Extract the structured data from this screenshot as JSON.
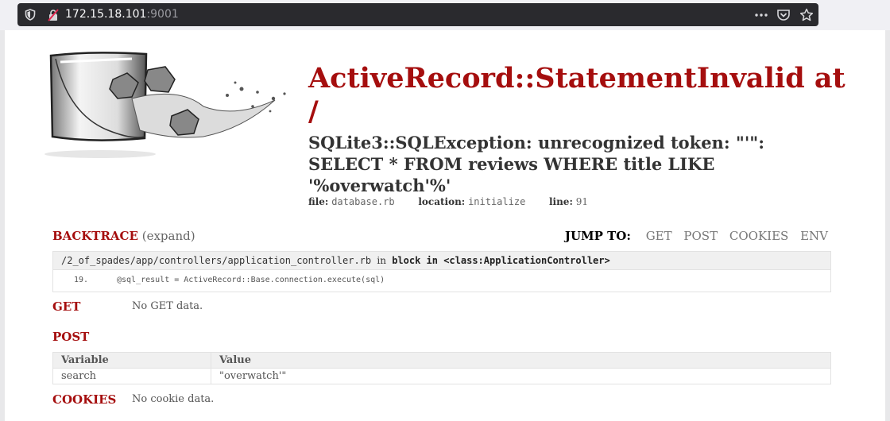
{
  "browser": {
    "url_host": "172.15.18.101",
    "url_port": ":9001",
    "icons": [
      "shield-icon",
      "insecure-lock-icon",
      "more-icon",
      "pocket-icon",
      "bookmark-star-icon"
    ]
  },
  "error": {
    "title": "ActiveRecord::StatementInvalid at /",
    "message": "SQLite3::SQLException: unrecognized token: \"'\": SELECT * FROM reviews WHERE title LIKE '%overwatch'%'",
    "file_label": "file:",
    "file": "database.rb",
    "location_label": "location:",
    "location": "initialize",
    "line_label": "line:",
    "line": "91"
  },
  "backtrace": {
    "heading": "BACKTRACE",
    "expand": "(expand)",
    "frame_path": "/2_of_spades/app/controllers/application_controller.rb",
    "frame_in": "in",
    "frame_context": "block in <class:ApplicationController>",
    "line_no": "19.",
    "code": "@sql_result = ActiveRecord::Base.connection.execute(sql)"
  },
  "jump": {
    "label": "JUMP TO:",
    "links": [
      "GET",
      "POST",
      "COOKIES",
      "ENV"
    ]
  },
  "get": {
    "heading": "GET",
    "value": "No GET data."
  },
  "post": {
    "heading": "POST",
    "columns": [
      "Variable",
      "Value"
    ],
    "rows": [
      {
        "variable": "search",
        "value": "\"overwatch'\""
      }
    ]
  },
  "cookies": {
    "heading": "COOKIES",
    "value": "No cookie data."
  },
  "colors": {
    "accent": "#a50e0e",
    "urlbar": "#2a2a2e"
  }
}
